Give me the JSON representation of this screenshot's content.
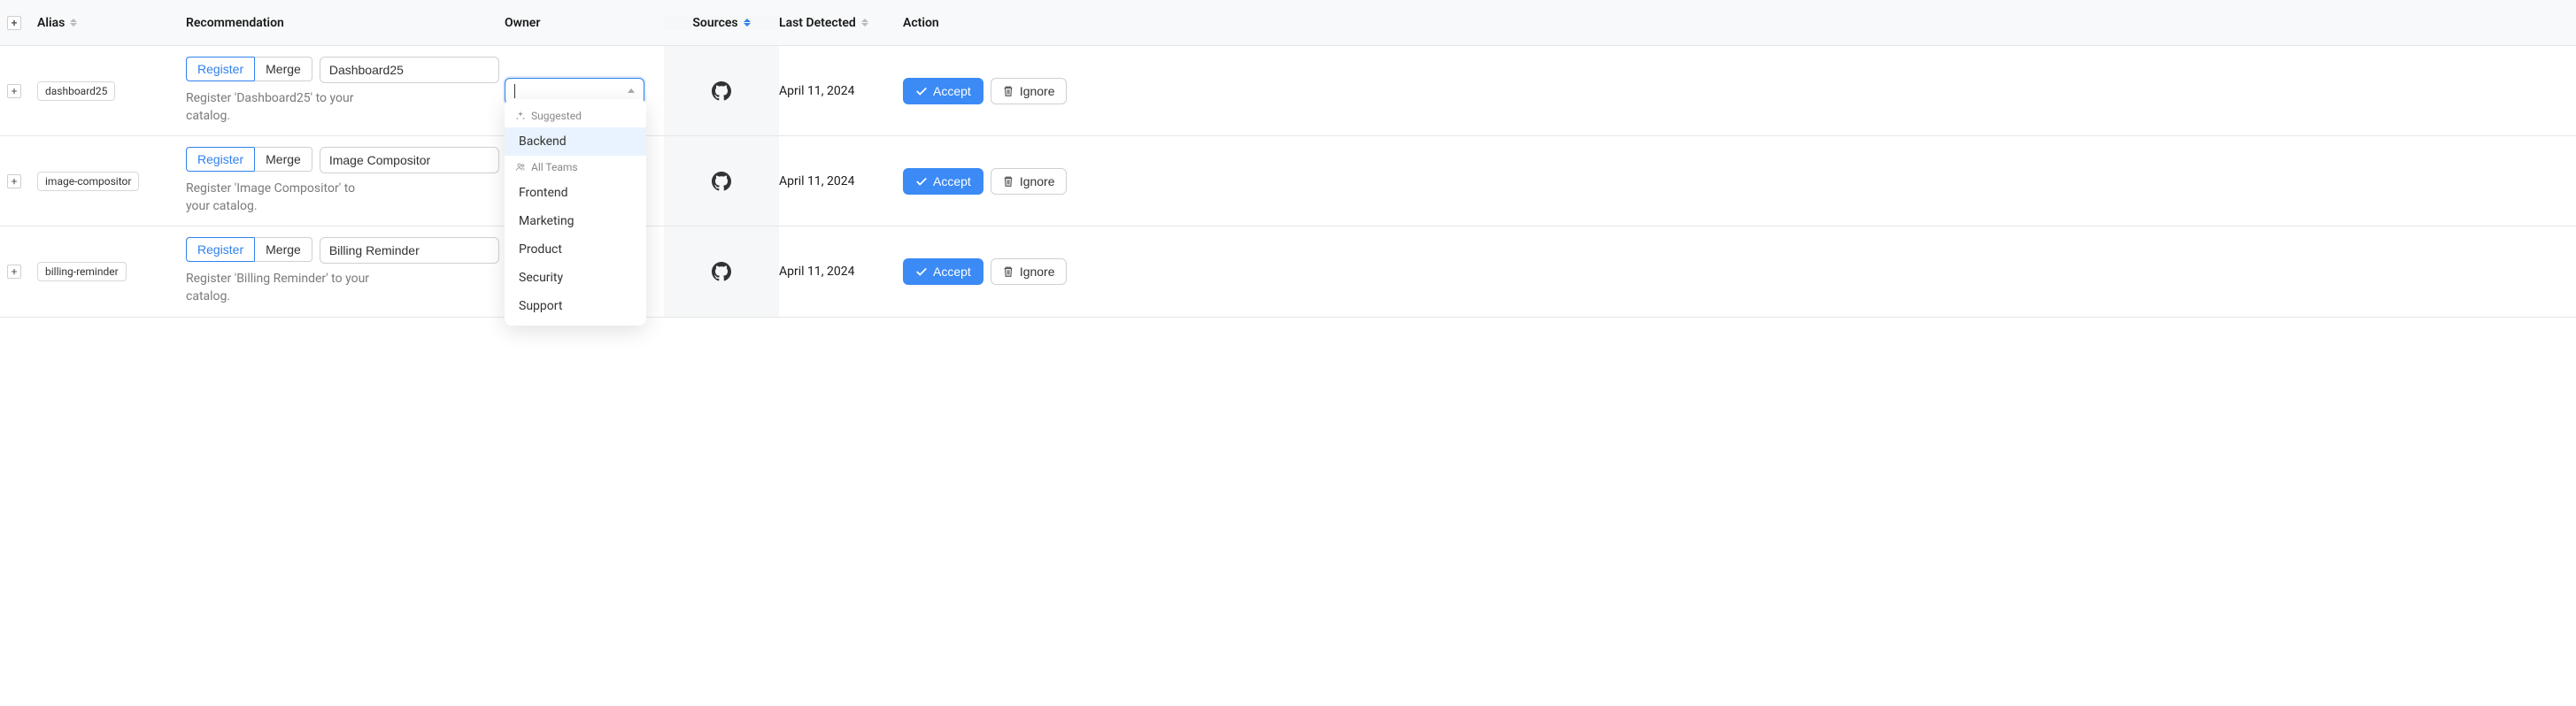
{
  "columns": {
    "alias": "Alias",
    "recommendation": "Recommendation",
    "owner": "Owner",
    "sources": "Sources",
    "last_detected": "Last Detected",
    "action": "Action"
  },
  "buttons": {
    "register": "Register",
    "merge": "Merge",
    "accept": "Accept",
    "ignore": "Ignore"
  },
  "rows": [
    {
      "alias": "dashboard25",
      "name_value": "Dashboard25",
      "help_text": "Register 'Dashboard25' to your catalog.",
      "last_detected": "April 11, 2024"
    },
    {
      "alias": "image-compositor",
      "name_value": "Image Compositor",
      "help_text": "Register 'Image Compositor' to your catalog.",
      "last_detected": "April 11, 2024"
    },
    {
      "alias": "billing-reminder",
      "name_value": "Billing Reminder",
      "help_text": "Register 'Billing Reminder' to your catalog.",
      "last_detected": "April 11, 2024"
    }
  ],
  "dropdown": {
    "suggested_label": "Suggested",
    "all_teams_label": "All Teams",
    "suggested": [
      "Backend"
    ],
    "all_teams": [
      "Frontend",
      "Marketing",
      "Product",
      "Security",
      "Support"
    ]
  }
}
